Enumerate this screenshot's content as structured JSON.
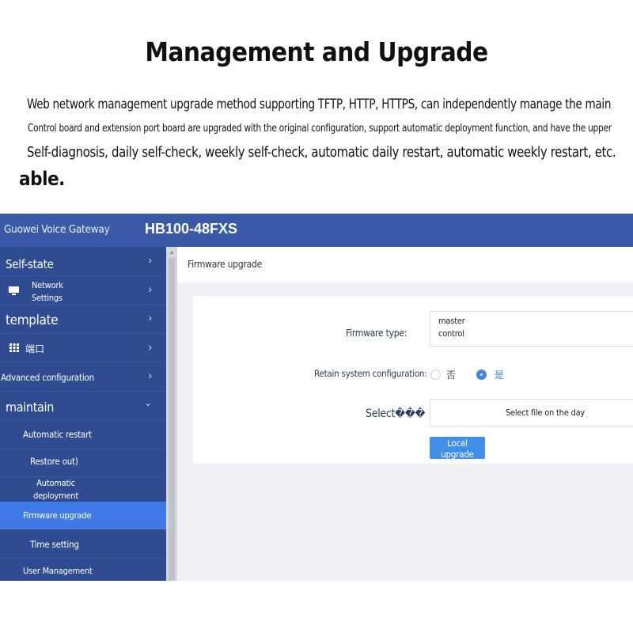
{
  "page": {
    "title": "Management and Upgrade",
    "desc_line1": "Web network management upgrade method supporting TFTP, HTTP, HTTPS, can independently manage the main",
    "desc_line2": "Control board and extension port board are upgraded with the original configuration, support automatic deployment function, and have the upper",
    "desc_line3": "Self-diagnosis, daily self-check, weekly self-check, automatic daily restart, automatic weekly restart, etc.",
    "desc_line4": "able."
  },
  "app": {
    "brand": "Guowei Voice Gateway",
    "model": "HB100-48FXS"
  },
  "sidebar": {
    "items": [
      {
        "label": "Self-state",
        "icon": "chevron-right-icon"
      },
      {
        "label": "Network\nSettings",
        "icon": "monitor-icon"
      },
      {
        "label": "template",
        "icon": "chevron-right-icon"
      },
      {
        "label": "端口",
        "icon": "grid-icon"
      },
      {
        "label": "Advanced configuration",
        "icon": "chevron-right-icon"
      },
      {
        "label": "maintain",
        "icon": "chevron-down-icon"
      },
      {
        "label": "Automatic restart"
      },
      {
        "label": "Restore out)"
      },
      {
        "label": "Automatic\ndeployment"
      },
      {
        "label": "Firmware upgrade",
        "active": true
      },
      {
        "label": "Time setting"
      },
      {
        "label": "User Management"
      }
    ]
  },
  "content": {
    "breadcrumb": "Firmware upgrade",
    "firmware_type_label": "Firmware type:",
    "firmware_type_value": "master\ncontrol",
    "retain_label": "Retain system configuration:",
    "retain_options": [
      "否",
      "是"
    ],
    "retain_selected": "是",
    "select_label": "Select���",
    "select_file_button": "Select file on the day",
    "local_upgrade_button": "Local upgrade"
  },
  "colors": {
    "topbar": "#3a5aa8",
    "sidebar": "#2f4b92",
    "active_item": "#3f7ae8",
    "button": "#3f8fe8"
  }
}
